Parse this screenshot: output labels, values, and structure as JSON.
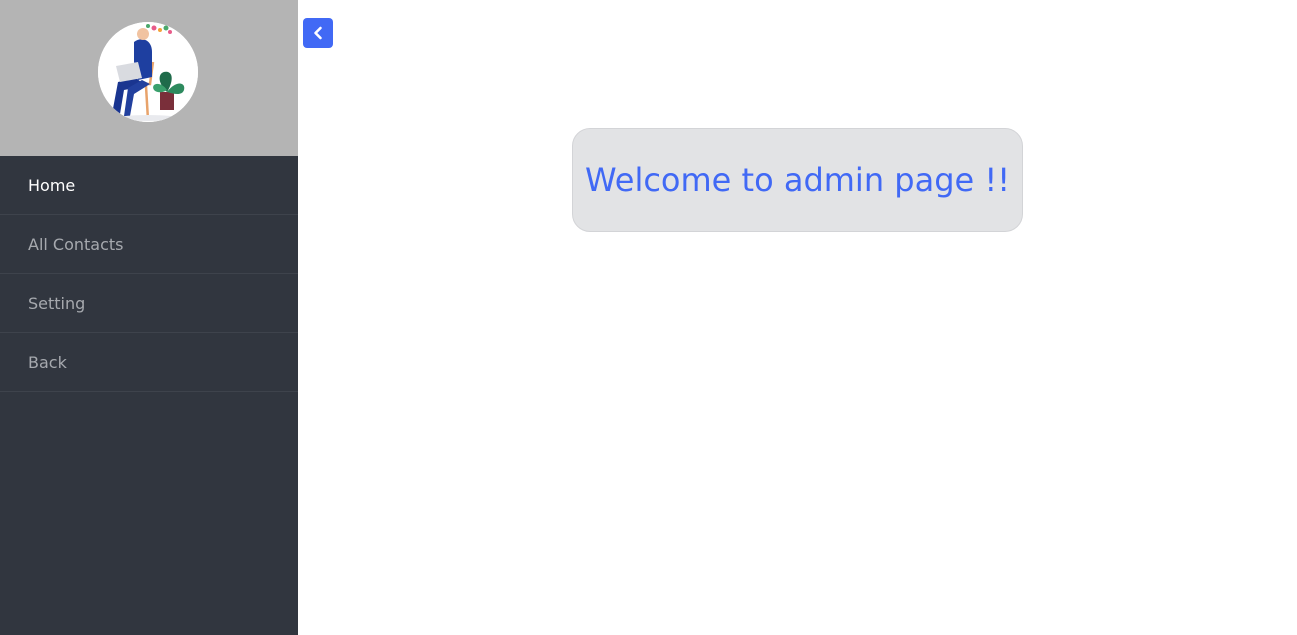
{
  "sidebar": {
    "avatar_icon": "user-avatar-illustration",
    "items": [
      {
        "label": "Home",
        "active": true
      },
      {
        "label": "All Contacts",
        "active": false
      },
      {
        "label": "Setting",
        "active": false
      },
      {
        "label": "Back",
        "active": false
      }
    ]
  },
  "toggle": {
    "icon": "chevron-left-icon"
  },
  "main": {
    "welcome_text": "Welcome to admin page !!"
  },
  "colors": {
    "accent": "#4169f5",
    "sidebar_bg": "#31363f",
    "sidebar_header_bg": "#b4b4b4",
    "card_bg": "#e2e3e5"
  }
}
